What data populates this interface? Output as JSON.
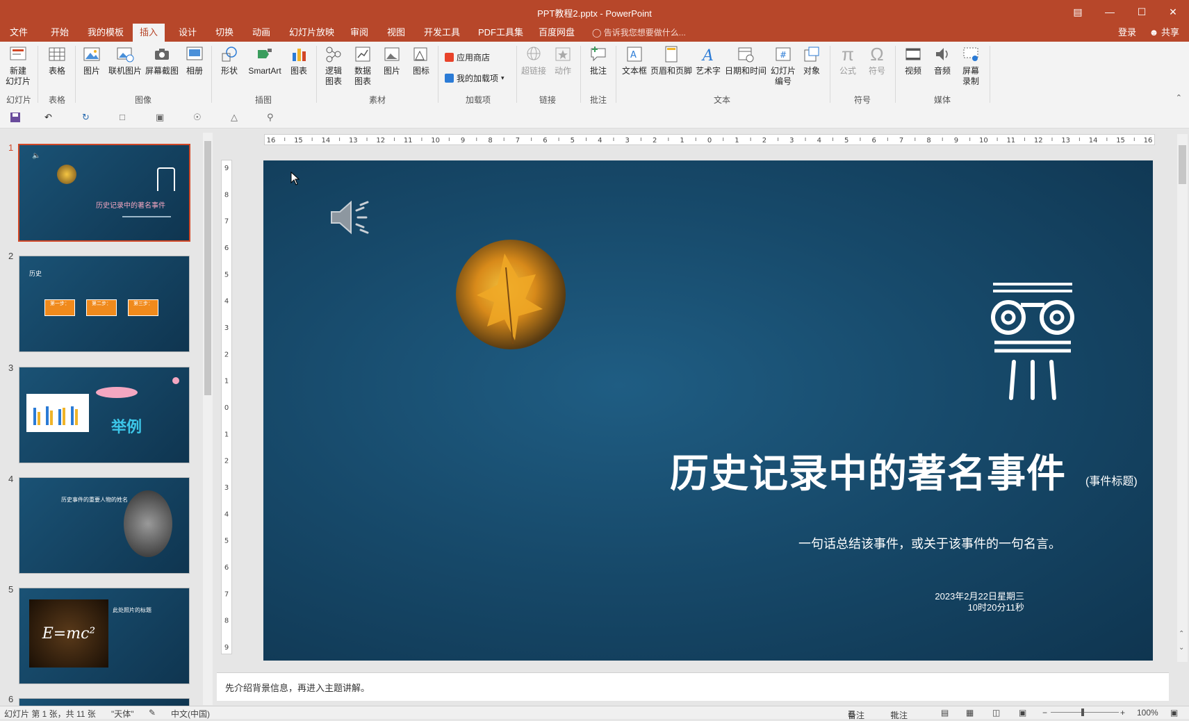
{
  "window": {
    "title": "PPT教程2.pptx - PowerPoint",
    "controls": [
      "ribbon-display",
      "minimize",
      "maximize",
      "close"
    ]
  },
  "tabs": [
    "文件",
    "开始",
    "我的模板",
    "插入",
    "设计",
    "切换",
    "动画",
    "幻灯片放映",
    "审阅",
    "视图",
    "开发工具",
    "PDF工具集",
    "百度网盘"
  ],
  "active_tab": "插入",
  "tell_me": "告诉我您想要做什么...",
  "account": {
    "login": "登录",
    "share": "共享"
  },
  "ribbon": {
    "buttons": {
      "new_slide": "新建\n幻灯片",
      "table": "表格",
      "picture": "图片",
      "online_picture": "联机图片",
      "screenshot": "屏幕截图",
      "album": "相册",
      "shapes": "形状",
      "smartart": "SmartArt",
      "chart": "图表",
      "logic_chart": "逻辑\n图表",
      "data_chart": "数据\n图表",
      "picture2": "图片",
      "icon": "图标",
      "app_store": "应用商店",
      "my_addins": "我的加载项",
      "hyperlink": "超链接",
      "action": "动作",
      "comment": "批注",
      "textbox": "文本框",
      "header_footer": "页眉和页脚",
      "wordart": "艺术字",
      "datetime": "日期和时间",
      "slide_number": "幻灯片\n编号",
      "object": "对象",
      "equation": "公式",
      "symbol": "符号",
      "video": "视频",
      "audio": "音频",
      "screen_record": "屏幕\n录制"
    },
    "groups": {
      "slides": "幻灯片",
      "tables": "表格",
      "images": "图像",
      "illustrations": "插图",
      "materials": "素材",
      "addins": "加载项",
      "links": "链接",
      "comments": "批注",
      "text": "文本",
      "symbols": "符号",
      "media": "媒体"
    }
  },
  "thumbnails": [
    {
      "num": "1",
      "title": "历史记录中的著名事件",
      "selected": true
    },
    {
      "num": "2",
      "title": "历史",
      "steps": [
        "第一步：",
        "第二步：",
        "第三步："
      ]
    },
    {
      "num": "3",
      "title": "举例"
    },
    {
      "num": "4",
      "title": "历史事件的重要人物的姓名"
    },
    {
      "num": "5",
      "title": "此处照片的标题",
      "formula": "E=mc²"
    },
    {
      "num": "6"
    }
  ],
  "ruler": {
    "h_ticks": [
      "16",
      "15",
      "14",
      "13",
      "12",
      "11",
      "10",
      "9",
      "8",
      "7",
      "6",
      "5",
      "4",
      "3",
      "2",
      "1",
      "0",
      "1",
      "2",
      "3",
      "4",
      "5",
      "6",
      "7",
      "8",
      "9",
      "10",
      "11",
      "12",
      "13",
      "14",
      "15",
      "16"
    ],
    "v_ticks": [
      "9",
      "8",
      "7",
      "6",
      "5",
      "4",
      "3",
      "2",
      "1",
      "0",
      "1",
      "2",
      "3",
      "4",
      "5",
      "6",
      "7",
      "8",
      "9"
    ]
  },
  "slide": {
    "title": "历史记录中的著名事件",
    "title_tag": "(事件标题)",
    "subtitle": "一句话总结该事件，或关于该事件的一句名言。",
    "date_line1": "2023年2月22日星期三",
    "date_line2": "10时20分11秒"
  },
  "notes": "先介绍背景信息，再进入主题讲解。",
  "status": {
    "slide_info": "幻灯片 第 1 张，共 11 张",
    "theme": "\"天体\"",
    "language": "中文(中国)",
    "notes_btn": "备注",
    "comments_btn": "批注",
    "zoom": "100%"
  },
  "colors": {
    "accent": "#b7472a",
    "slide_bg": "#174a6b",
    "step_box": "#f08a1c"
  }
}
